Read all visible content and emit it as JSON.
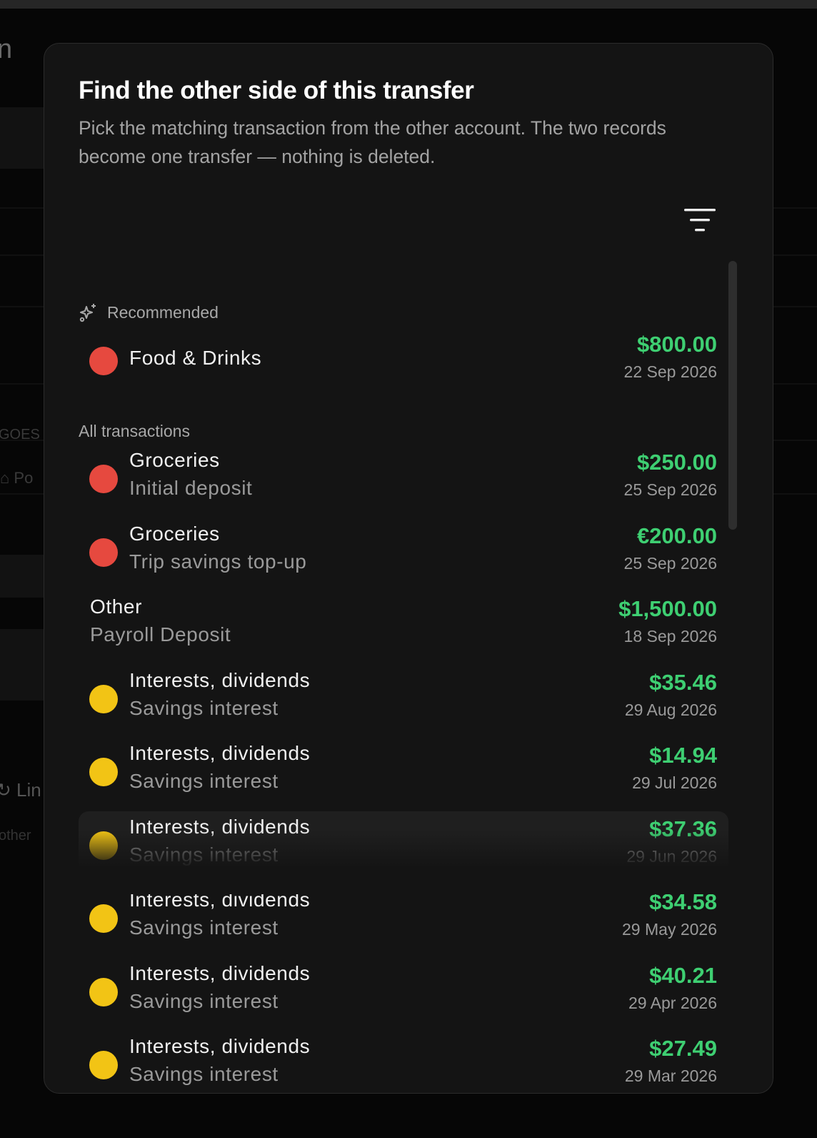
{
  "background": {
    "title_fragment": "n",
    "label_fragment": "GOES",
    "item_fragment": "Po",
    "link_fragment": "Lin",
    "note_fragment": "other"
  },
  "modal": {
    "title": "Find the other side of this transfer",
    "description": "Pick the matching transaction from the other account. The two records become one transfer — nothing is deleted.",
    "filter_icon": "filter-lines-icon"
  },
  "colors": {
    "red_dot": "#e6493f",
    "yellow_dot": "#f2c415",
    "amount_green": "#3ecf72"
  },
  "recommended": {
    "label": "Recommended",
    "icon": "sparkle-icon",
    "items": [
      {
        "category": "Food & Drinks",
        "note": "",
        "amount": "$800.00",
        "date": "22 Sep 2026",
        "dot": "red"
      }
    ]
  },
  "all_transactions": {
    "label": "All transactions",
    "items": [
      {
        "category": "Groceries",
        "note": "Initial deposit",
        "amount": "$250.00",
        "date": "25 Sep 2026",
        "dot": "red"
      },
      {
        "category": "Groceries",
        "note": "Trip savings top-up",
        "amount": "€200.00",
        "date": "25 Sep 2026",
        "dot": "red"
      },
      {
        "category": "Other",
        "note": "Payroll Deposit",
        "amount": "$1,500.00",
        "date": "18 Sep 2026",
        "dot": "none"
      },
      {
        "category": "Interests, dividends",
        "note": "Savings interest",
        "amount": "$35.46",
        "date": "29 Aug 2026",
        "dot": "yellow"
      },
      {
        "category": "Interests, dividends",
        "note": "Savings interest",
        "amount": "$14.94",
        "date": "29 Jul 2026",
        "dot": "yellow"
      },
      {
        "category": "Interests, dividends",
        "note": "Savings interest",
        "amount": "$37.36",
        "date": "29 Jun 2026",
        "dot": "yellow",
        "hovered": true
      },
      {
        "category": "Interests, dividends",
        "note": "Savings interest",
        "amount": "$34.58",
        "date": "29 May 2026",
        "dot": "yellow"
      },
      {
        "category": "Interests, dividends",
        "note": "Savings interest",
        "amount": "$40.21",
        "date": "29 Apr 2026",
        "dot": "yellow"
      },
      {
        "category": "Interests, dividends",
        "note": "Savings interest",
        "amount": "$27.49",
        "date": "29 Mar 2026",
        "dot": "yellow"
      }
    ]
  }
}
